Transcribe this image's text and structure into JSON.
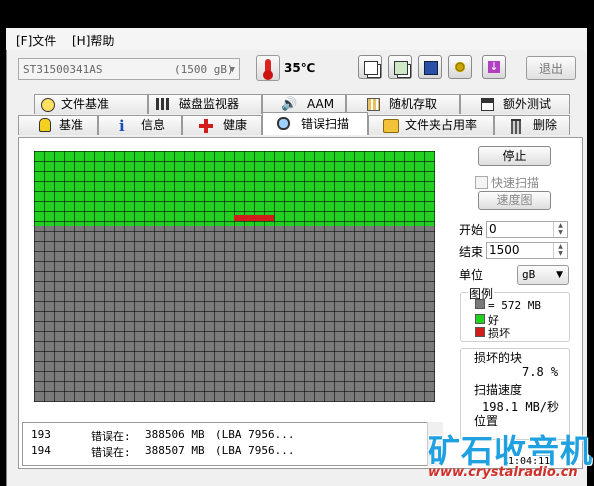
{
  "menu": {
    "file": "[F]文件",
    "help": "[H]帮助"
  },
  "toolbar": {
    "drive": "ST31500341AS",
    "capacity": "(1500 gB)",
    "temperature": "35℃",
    "exit_label": "退出",
    "icons": [
      "copy-icon",
      "copy-all-icon",
      "save-icon",
      "settings-icon",
      "download-icon"
    ]
  },
  "tabs_top": [
    {
      "label": "文件基准",
      "icon": "info-bubble-icon"
    },
    {
      "label": "磁盘监视器",
      "icon": "bar-chart-icon"
    },
    {
      "label": "AAM",
      "icon": "speaker-icon"
    },
    {
      "label": "随机存取",
      "icon": "random-grid-icon"
    },
    {
      "label": "额外测试",
      "icon": "extra-test-icon"
    }
  ],
  "tabs_bottom": [
    {
      "label": "基准",
      "icon": "bulb-icon"
    },
    {
      "label": "信息",
      "icon": "info-icon"
    },
    {
      "label": "健康",
      "icon": "health-cross-icon"
    },
    {
      "label": "错误扫描",
      "icon": "magnifier-icon",
      "active": true
    },
    {
      "label": "文件夹占用率",
      "icon": "folder-icon"
    },
    {
      "label": "删除",
      "icon": "trash-icon"
    }
  ],
  "scan": {
    "stop_label": "停止",
    "quick_scan_label": "快速扫描",
    "speed_map_label": "速度图",
    "start_label": "开始",
    "start_value": "0",
    "end_label": "结束",
    "end_value": "1500",
    "unit_label": "单位",
    "unit_value": "gB",
    "legend_title": "图例",
    "legend_block": "= 572 MB",
    "legend_good": "好",
    "legend_bad": "损坏",
    "damaged_label": "损坏的块",
    "damaged_value": "7.8 %",
    "speed_label": "扫描速度",
    "speed_value": "198.1 MB/秒",
    "position_label": "位置",
    "elapsed": "1:04:11",
    "progress_fraction": 0.26,
    "colors": {
      "good": "#21d021",
      "bad": "#d21c1c",
      "unscanned": "#7a7a7a"
    }
  },
  "log": [
    {
      "num": "193",
      "text": "错误在:",
      "mb": "388506 MB",
      "lba": "(LBA 7956..."
    },
    {
      "num": "194",
      "text": "错误在:",
      "mb": "388507 MB",
      "lba": "(LBA 7956..."
    }
  ],
  "watermark": {
    "title": "矿石收音机",
    "url": "www.crystalradio.cn"
  }
}
